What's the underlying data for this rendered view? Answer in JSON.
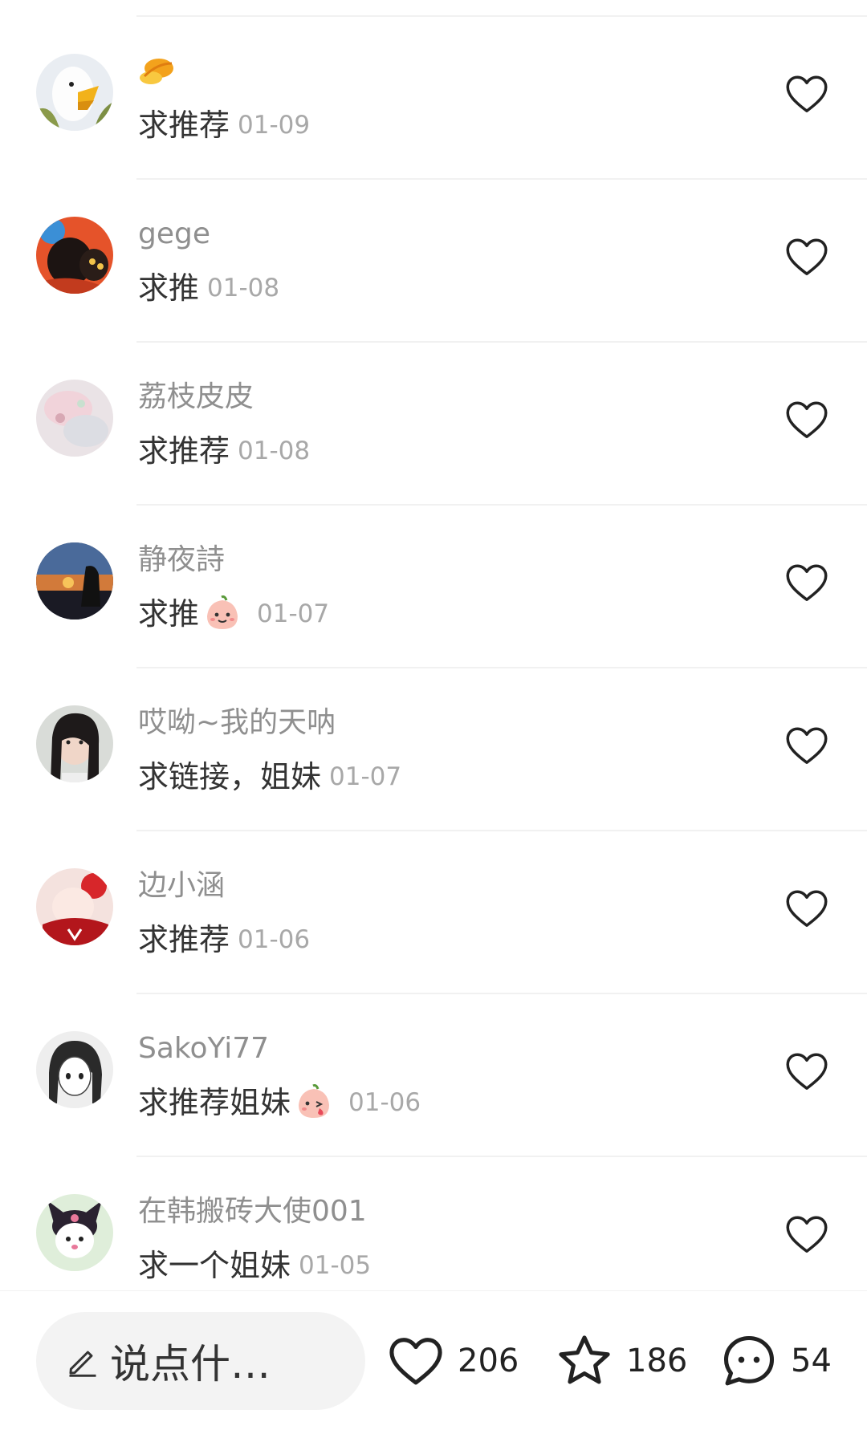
{
  "comments": [
    {
      "name": "",
      "text": "求推荐",
      "date": "01-09",
      "avatar": "duck",
      "name_emoji": "sticker-icon",
      "sticker": ""
    },
    {
      "name": "gege",
      "text": "求推",
      "date": "01-08",
      "avatar": "anime-red",
      "sticker": ""
    },
    {
      "name": "荔枝皮皮",
      "text": "求推荐",
      "date": "01-08",
      "avatar": "pink-blur",
      "sticker": ""
    },
    {
      "name": "静夜詩",
      "text": "求推",
      "date": "01-07",
      "avatar": "sunset",
      "sticker": "peach-smile"
    },
    {
      "name": "哎呦~我的天呐",
      "text": "求链接，姐妹",
      "date": "01-07",
      "avatar": "girl-photo",
      "sticker": ""
    },
    {
      "name": "边小涵",
      "text": "求推荐",
      "date": "01-06",
      "avatar": "red-anime",
      "sticker": ""
    },
    {
      "name": "SakoYi77",
      "text": "求推荐姐妹",
      "date": "01-06",
      "avatar": "manga-girl",
      "sticker": "peach-kiss"
    },
    {
      "name": "在韩搬砖大使001",
      "text": "求一个姐妹",
      "date": "01-05",
      "avatar": "kuromi",
      "sticker": ""
    }
  ],
  "bottom_bar": {
    "compose_placeholder": "说点什…",
    "likes": "206",
    "stars": "186",
    "comments": "54"
  },
  "colors": {
    "name": "#8f8f8f",
    "text": "#333333",
    "date": "#a8a8a8",
    "divider": "#f1f1f1",
    "compose_bg": "#f3f3f3"
  }
}
